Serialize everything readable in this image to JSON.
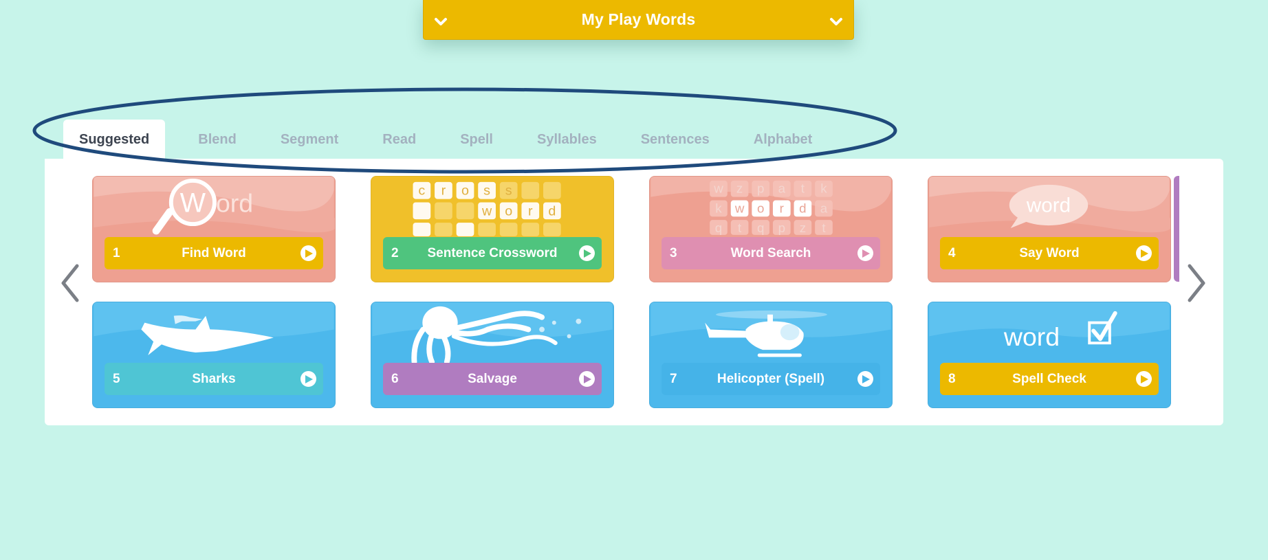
{
  "wordlist": {
    "title": "My Play Words"
  },
  "tabs": [
    {
      "label": "Suggested",
      "active": true
    },
    {
      "label": "Blend"
    },
    {
      "label": "Segment"
    },
    {
      "label": "Read"
    },
    {
      "label": "Spell"
    },
    {
      "label": "Syllables"
    },
    {
      "label": "Sentences"
    },
    {
      "label": "Alphabet"
    }
  ],
  "games": [
    {
      "num": "1",
      "name": "Find Word",
      "bg": "#eea091",
      "label_color": "#ecb900",
      "art_text": "Word"
    },
    {
      "num": "2",
      "name": "Sentence Crossword",
      "bg": "#f0c02a",
      "label_color": "#4fc47e",
      "art_text": "cross word"
    },
    {
      "num": "3",
      "name": "Word Search",
      "bg": "#eea091",
      "label_color": "#df8fb1",
      "art_text": "wzpatk kworda qtqpzt"
    },
    {
      "num": "4",
      "name": "Say Word",
      "bg": "#eea091",
      "label_color": "#ecb900",
      "art_text": "word"
    },
    {
      "num": "5",
      "name": "Sharks",
      "bg": "#4cb8ec",
      "label_color": "#4fc5d4"
    },
    {
      "num": "6",
      "name": "Salvage",
      "bg": "#4cb8ec",
      "label_color": "#b07cc0"
    },
    {
      "num": "7",
      "name": "Helicopter (Spell)",
      "bg": "#4cb8ec",
      "label_color": "#45b3e8"
    },
    {
      "num": "8",
      "name": "Spell Check",
      "bg": "#4cb8ec",
      "label_color": "#ecb900",
      "art_text": "word"
    }
  ],
  "icons": {
    "dropdown": "chevron-down-icon",
    "prev": "chevron-left-icon",
    "next": "chevron-right-icon",
    "play": "play-icon"
  },
  "colors": {
    "background": "#c7f4ea",
    "accent": "#ecb900",
    "annotation": "#1f4a7c"
  }
}
